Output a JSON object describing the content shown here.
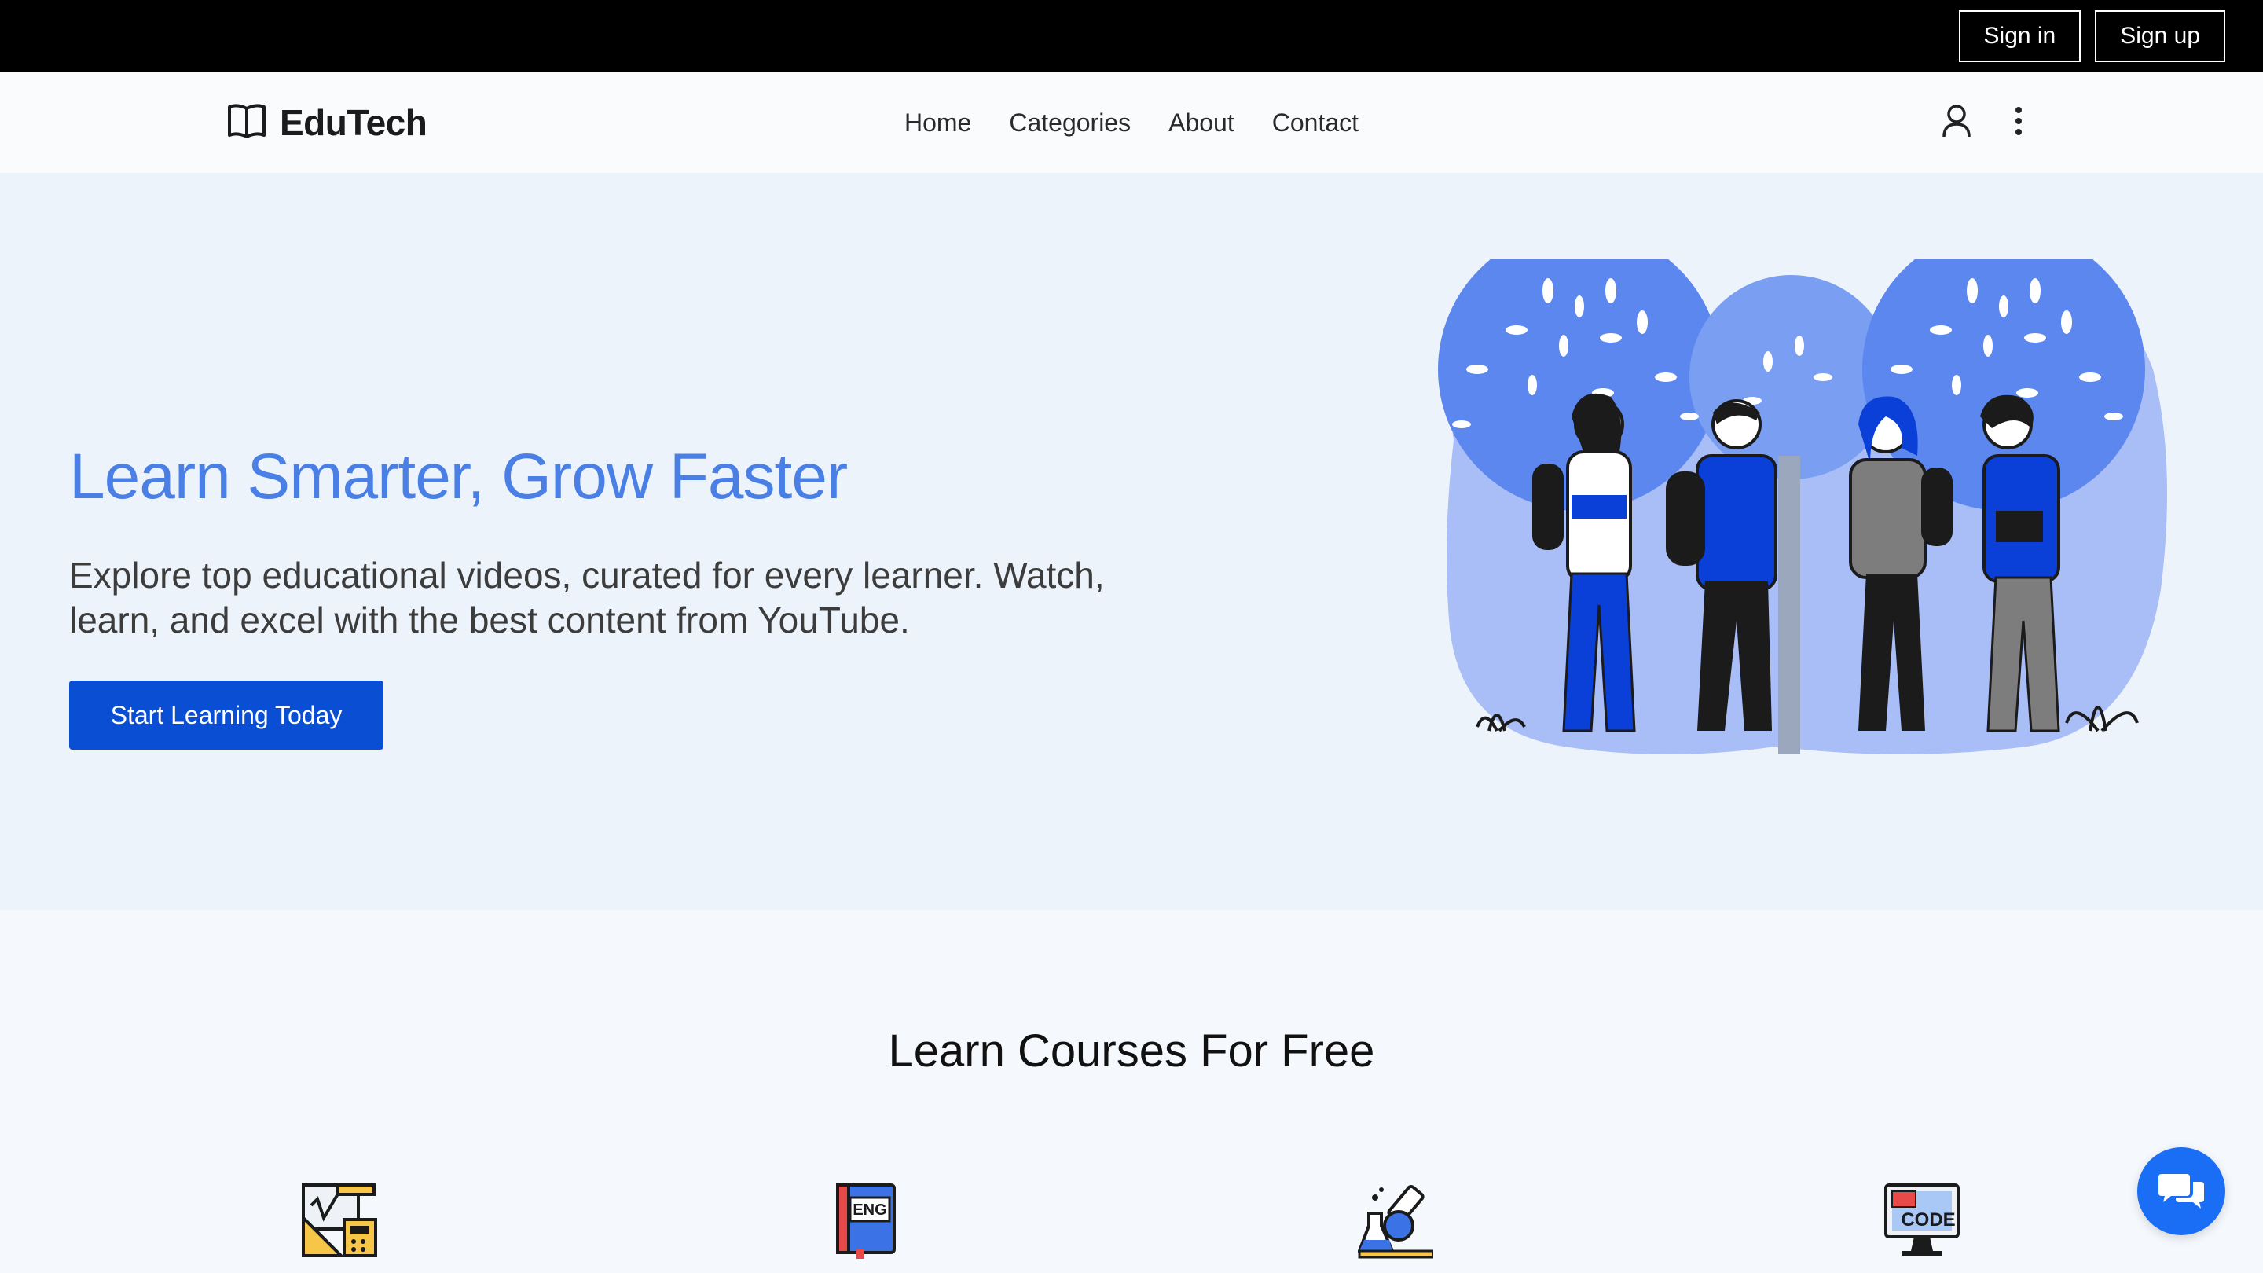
{
  "topbar": {
    "sign_in": "Sign in",
    "sign_up": "Sign up"
  },
  "navbar": {
    "brand": "EduTech",
    "brand_icon": "open-book-icon",
    "links": [
      "Home",
      "Categories",
      "About",
      "Contact"
    ],
    "icons": [
      "user-icon",
      "kebab-menu-icon"
    ]
  },
  "hero": {
    "title": "Learn Smarter, Grow Faster",
    "description": "Explore top educational videos, curated for every learner. Watch, learn, and excel with the best content from YouTube.",
    "cta": "Start Learning Today"
  },
  "courses": {
    "title": "Learn Courses For Free",
    "icons": [
      "math-tools-icon",
      "english-book-icon",
      "science-lab-icon",
      "code-monitor-icon"
    ],
    "english_label": "ENG",
    "code_label": "CODE"
  },
  "chat": {
    "icon": "chat-bubbles-icon"
  },
  "colors": {
    "accent": "#4a80e6",
    "primary_button": "#0a4fd3",
    "chat_button": "#1a6ef5",
    "topbar": "#000000",
    "hero_bg": "#edf3fb"
  }
}
